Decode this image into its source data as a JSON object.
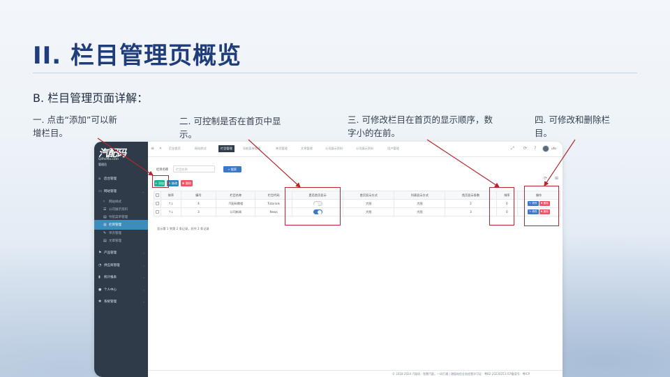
{
  "slide": {
    "title": "II. 栏目管理页概览",
    "subtitle": "B. 栏目管理页面详解：",
    "notes": [
      "一. 点击“添加”可以新增栏目。",
      "二. 可控制是否在首页中显示。",
      "三. 可修改栏目在首页的显示顺序，数字小的在前。",
      "四. 可修改和删除栏目。"
    ]
  },
  "app": {
    "logo": {
      "main": "汽配码",
      "url": "QiPeiMa.com",
      "sub": "管理员"
    },
    "sidebar": [
      {
        "label": "后台管理",
        "icon": "home-icon",
        "type": "group"
      },
      {
        "label": "网站管理",
        "icon": "monitor-icon",
        "type": "group-open"
      },
      {
        "label": "网站样式",
        "icon": "style-icon",
        "type": "sub"
      },
      {
        "label": "公司展示资料",
        "icon": "list-icon",
        "type": "sub"
      },
      {
        "label": "导航菜单管理",
        "icon": "menu-icon",
        "type": "sub"
      },
      {
        "label": "栏目管理",
        "icon": "grid-icon",
        "type": "active"
      },
      {
        "label": "单页管理",
        "icon": "edit-icon",
        "type": "sub"
      },
      {
        "label": "文章管理",
        "icon": "doc-icon",
        "type": "sub"
      },
      {
        "label": "产品管理",
        "icon": "tag-icon",
        "type": "group"
      },
      {
        "label": "供应商管理",
        "icon": "user-icon",
        "type": "group"
      },
      {
        "label": "统计报表",
        "icon": "chart-icon",
        "type": "group"
      },
      {
        "label": "个人中心",
        "icon": "person-icon",
        "type": "group"
      },
      {
        "label": "系统管理",
        "icon": "gear-icon",
        "type": "group"
      }
    ],
    "tabs": [
      "后台首页",
      "网站样式",
      "栏目管理",
      "导航菜单管理",
      "单页管理",
      "文章管理",
      "公司展示资料",
      "公司展示资料",
      "用户管理"
    ],
    "user": "ufo",
    "search": {
      "label": "栏目名称",
      "placeholder": "栏目名称",
      "button": "搜索"
    },
    "toolbar": {
      "add": "+ 添加",
      "edit": "修改",
      "delete": "删除"
    },
    "table": {
      "headers": [
        "排序",
        "编号",
        "栏目名称",
        "栏目代码",
        "是否首页显示",
        "首页显示方式",
        "列表显示方式",
        "首页显示条数",
        "排序",
        "操作"
      ],
      "rows": [
        {
          "order": "↑↓",
          "id": "4",
          "name": "汽配码教程",
          "code": "Tutorials",
          "show": false,
          "home_mode": "大图",
          "list_mode": "大图",
          "count": "2",
          "sort": "0"
        },
        {
          "order": "↑↓",
          "id": "3",
          "name": "公司新闻",
          "code": "News",
          "show": true,
          "home_mode": "大图",
          "list_mode": "大图",
          "count": "3",
          "sort": "0"
        }
      ],
      "row_edit": "修改",
      "row_delete": "删除"
    },
    "pager": "显示第 1 到第 2 条记录，总共 2 条记录",
    "footer": "© 2018-2024 汽配码 · 智慧汽配，一码打通 | 增值电信业务经营许可证：粤B2-20230253 ICP备案号：粤ICP"
  },
  "colors": {
    "title": "#1f3d7a",
    "highlight": "#b3282d",
    "sidebar": "#2f3b49",
    "active": "#3c8dbc"
  }
}
